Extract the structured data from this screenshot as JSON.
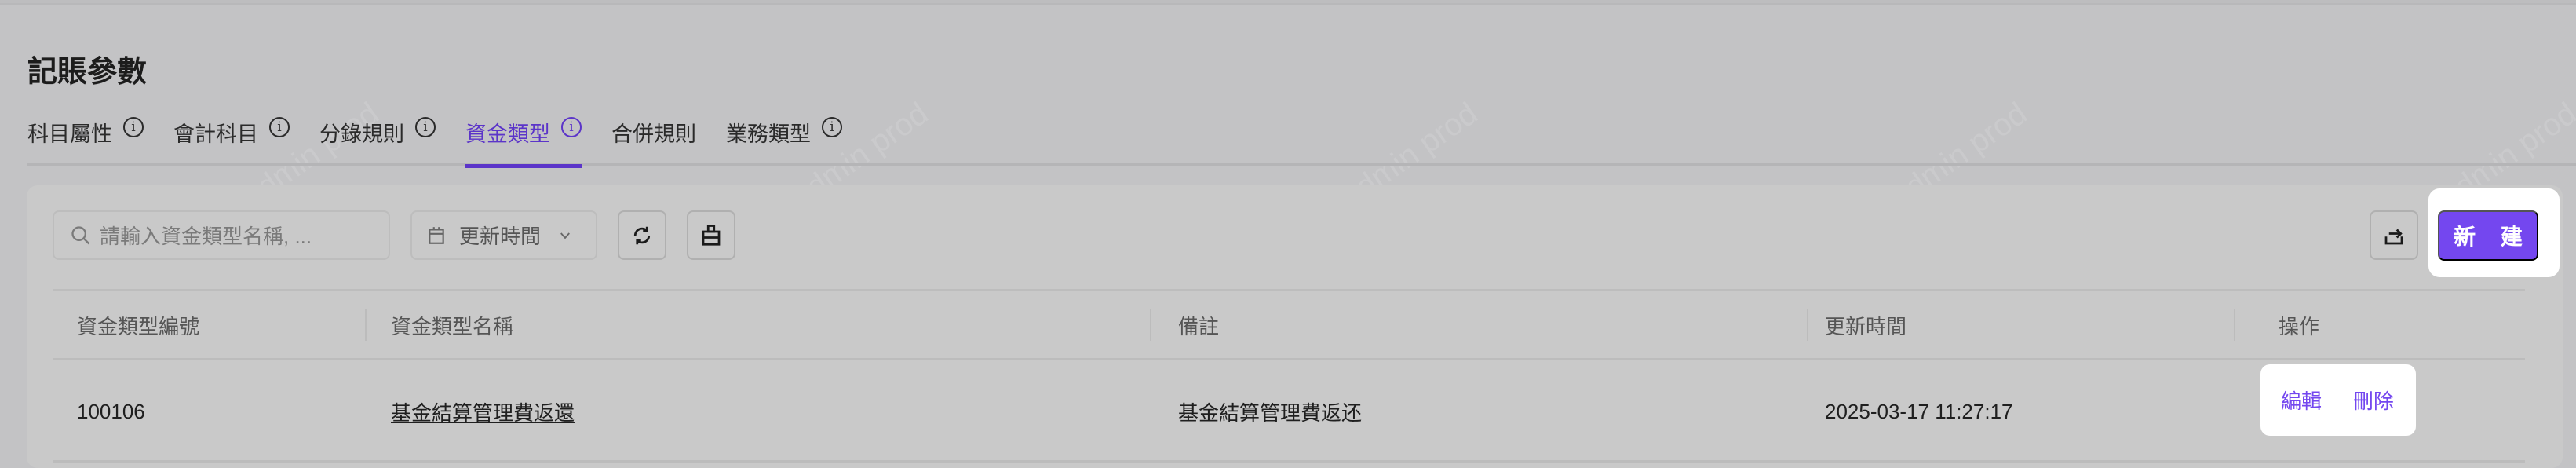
{
  "page_title": "記賬參數",
  "tabs": [
    {
      "label": "科目屬性",
      "info": true
    },
    {
      "label": "會計科目",
      "info": true
    },
    {
      "label": "分錄規則",
      "info": true
    },
    {
      "label": "資金類型",
      "info": true,
      "active": true
    },
    {
      "label": "合併規則",
      "info": false
    },
    {
      "label": "業務類型",
      "info": true
    }
  ],
  "toolbar": {
    "search_placeholder": "請輸入資金類型名稱, ...",
    "date_filter_label": "更新時間",
    "new_button_label": "新 建"
  },
  "table": {
    "columns": [
      "資金類型編號",
      "資金類型名稱",
      "備註",
      "更新時間",
      "操作"
    ],
    "rows": [
      {
        "code": "100106",
        "name": "基金結算管理費返還",
        "remark": "基金結算管理費返还",
        "updated": "2025-03-17 11:27:17",
        "edit": "編輯",
        "delete": "刪除"
      }
    ]
  },
  "watermark": "LongPort Test Admin prod",
  "colors": {
    "accent": "#7447ef",
    "active_tab": "#5b34c9"
  }
}
